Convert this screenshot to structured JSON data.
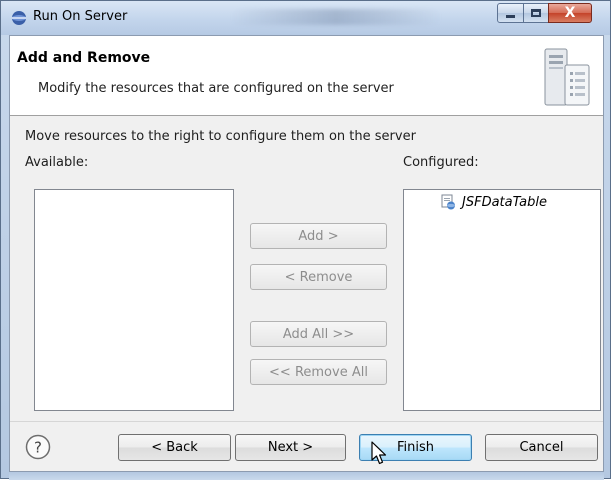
{
  "window": {
    "title": "Run On Server",
    "icon": "server-run-icon",
    "controls": {
      "minimize": "minimize-icon",
      "maximize": "maximize-icon",
      "close_label": "X"
    }
  },
  "banner": {
    "title": "Add and Remove",
    "description": "Modify the resources that are configured on the server",
    "image": "wizard-banner-server-icon"
  },
  "instructions": "Move resources to the right to configure them on the server",
  "available": {
    "label": "Available:",
    "items": []
  },
  "configured": {
    "label": "Configured:",
    "items": [
      {
        "label": "JSFDataTable",
        "icon": "web-project-icon"
      }
    ]
  },
  "actions": {
    "add": "Add >",
    "remove": "< Remove",
    "add_all": "Add All >>",
    "remove_all": "<< Remove All"
  },
  "footer": {
    "help": "?",
    "back": "< Back",
    "next": "Next >",
    "finish": "Finish",
    "cancel": "Cancel"
  },
  "colors": {
    "accent": "#3c7fb1",
    "disabled_text": "#8d8d8d",
    "close_button": "#c4432a"
  }
}
